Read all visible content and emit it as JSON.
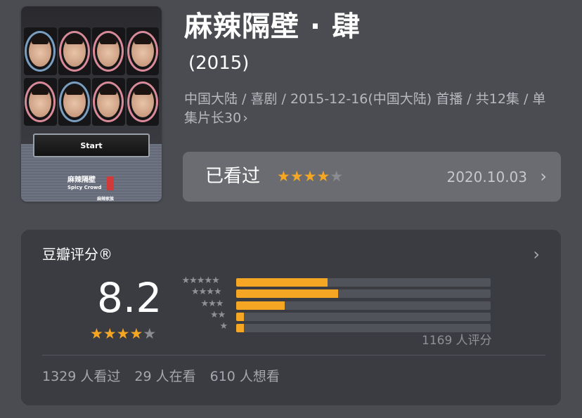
{
  "poster": {
    "start_label": "Start",
    "logo_title": "麻辣隔壁",
    "logo_subtitle": "Spicy Crowd",
    "logo_maker": "麻辣家族",
    "face_rings": [
      "blue",
      "pink",
      "pink",
      "pink",
      "pink",
      "blue",
      "pink",
      "pink"
    ]
  },
  "title": "麻辣隔壁 · 肆",
  "year": "(2015)",
  "meta": "中国大陆 / 喜剧 / 2015-12-16(中国大陆) 首播 / 共12集 / 单集片长30",
  "meta_chevron": "›",
  "watched": {
    "label": "已看过",
    "stars_filled": 4,
    "stars_total": 5,
    "date": "2020.10.03",
    "chevron": "›"
  },
  "rating": {
    "title": "豆瓣评分®",
    "chevron": "›",
    "score": "8.2",
    "stars_filled": 4,
    "stars_total": 5,
    "distribution": [
      {
        "label": "★★★★★",
        "percent": 36
      },
      {
        "label": "★★★★",
        "percent": 40
      },
      {
        "label": "★★★",
        "percent": 19
      },
      {
        "label": "★★",
        "percent": 3
      },
      {
        "label": "★",
        "percent": 3
      }
    ],
    "count_text": "1169 人评分"
  },
  "stats": {
    "watched": "1329 人看过",
    "watching": "29 人在看",
    "want": "610 人想看"
  },
  "colors": {
    "accent": "#f5a623",
    "background": "#4a4c52",
    "card": "#3a3c42",
    "watched_bar": "#6a6c71"
  }
}
